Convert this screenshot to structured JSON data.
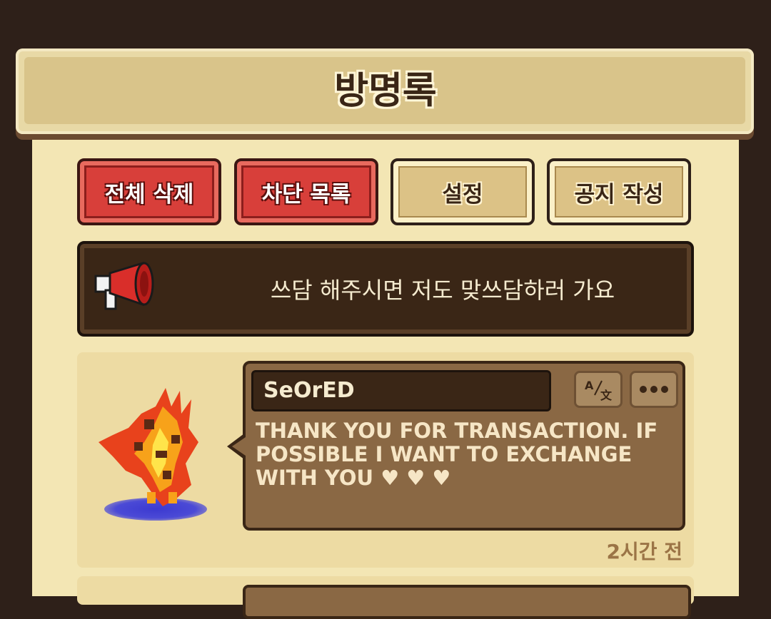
{
  "header": {
    "title": "방명록"
  },
  "toolbar": {
    "delete_all_label": "전체 삭제",
    "block_list_label": "차단 목록",
    "settings_label": "설정",
    "write_notice_label": "공지 작성"
  },
  "notice": {
    "text": "쓰담 해주시면 저도 맞쓰담하러 가요"
  },
  "entries": [
    {
      "author": "SeOrED",
      "message": "THANK YOU FOR TRANSACTION. IF POSSIBLE I WANT TO EXCHANGE WITH YOU ♥ ♥ ♥",
      "time": "2시간 전"
    }
  ],
  "icons": [
    "megaphone-icon",
    "translate-icon",
    "more-options-icon"
  ],
  "colors": {
    "red_button": "#d83f3a",
    "tan_button": "#dcc286",
    "bubble": "#8a6844",
    "background": "#f3e6b4"
  }
}
